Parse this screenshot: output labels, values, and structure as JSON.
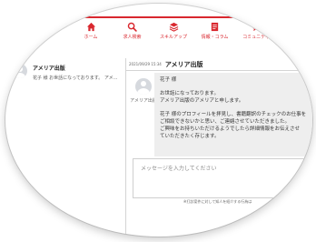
{
  "nav": {
    "items": [
      {
        "label": "ホーム",
        "icon": "home-icon"
      },
      {
        "label": "求人検索",
        "icon": "search-icon"
      },
      {
        "label": "スキルアップ",
        "icon": "layers-icon"
      },
      {
        "label": "情報・コラム",
        "icon": "document-icon"
      },
      {
        "label": "コミュニティ",
        "icon": "chat-icon"
      }
    ],
    "accent_color": "#d9282f"
  },
  "thread_list": {
    "items": [
      {
        "name": "アメリア出版",
        "preview": "花子 様 お世話になっております。 アメ..."
      }
    ]
  },
  "conversation": {
    "date": "2021/09/29 15:34",
    "title": "アメリア出版",
    "message": {
      "sender": "アメリア出版",
      "lines": [
        "花子 様",
        "",
        "お世話になっております。",
        "アメリア出版のアメリアと申します。",
        "",
        "花子 様のプロフィールを拝見し、書籍翻訳のチェックのお仕事を",
        "ご相談できないかと思い、ご連絡させていただきました。",
        "ご興味をお持ちいただけるようでしたら詳細情報をお伝えさせ",
        "ていただきたく存じます。"
      ]
    }
  },
  "composer": {
    "placeholder": "メッセージを入力してください"
  },
  "notice": "※打診案件に対して知人を紹介する行為は"
}
